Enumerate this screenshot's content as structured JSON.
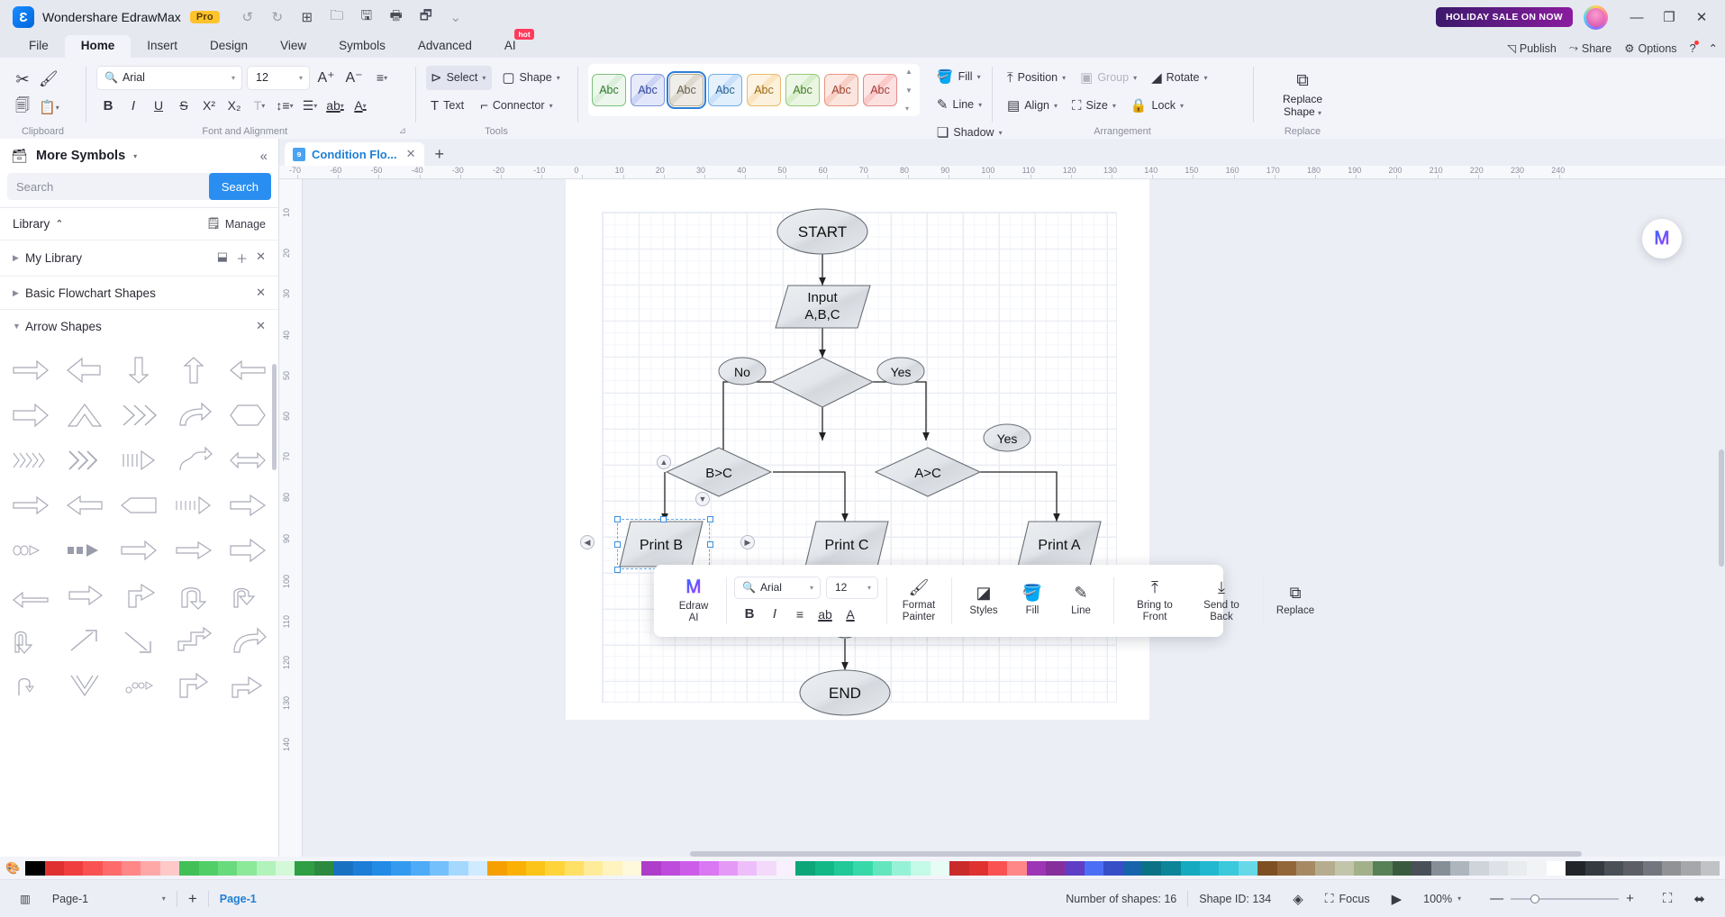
{
  "titlebar": {
    "app_name": "Wondershare EdrawMax",
    "pro_badge": "Pro",
    "quick_access": [
      {
        "name": "undo-icon",
        "glyph": "↩"
      },
      {
        "name": "redo-icon",
        "glyph": "↪"
      },
      {
        "name": "new-icon",
        "glyph": "⊞"
      },
      {
        "name": "open-icon",
        "glyph": "🗀"
      },
      {
        "name": "save-icon",
        "glyph": "🖫"
      },
      {
        "name": "print-icon",
        "glyph": "🖶"
      },
      {
        "name": "export-icon",
        "glyph": "🗗"
      },
      {
        "name": "more-icon",
        "glyph": "⌄"
      }
    ],
    "sale_label": "HOLIDAY SALE ON NOW",
    "minimize": "—",
    "maximize": "❐",
    "close": "✕"
  },
  "menubar": {
    "items": [
      {
        "label": "File",
        "active": false
      },
      {
        "label": "Home",
        "active": true
      },
      {
        "label": "Insert",
        "active": false
      },
      {
        "label": "Design",
        "active": false
      },
      {
        "label": "View",
        "active": false
      },
      {
        "label": "Symbols",
        "active": false
      },
      {
        "label": "Advanced",
        "active": false
      },
      {
        "label": "AI",
        "active": false,
        "badge": "hot"
      }
    ],
    "right": [
      {
        "label": "Publish",
        "icon": "publish-icon",
        "glyph": "◺"
      },
      {
        "label": "Share",
        "icon": "share-icon",
        "glyph": "⌁"
      },
      {
        "label": "Options",
        "icon": "gear-icon",
        "glyph": "⚙"
      },
      {
        "label": "",
        "icon": "help-icon",
        "glyph": "?"
      },
      {
        "label": "",
        "icon": "chevron-up-icon",
        "glyph": "⌃"
      }
    ]
  },
  "ribbon": {
    "groups": [
      {
        "name": "Clipboard",
        "label": "Clipboard"
      },
      {
        "name": "Font and Alignment",
        "label": "Font and Alignment"
      },
      {
        "name": "Tools",
        "label": "Tools"
      },
      {
        "name": "Styles",
        "label": "Styles"
      },
      {
        "name": "Arrangement",
        "label": "Arrangement"
      },
      {
        "name": "Replace",
        "label": "Replace"
      }
    ],
    "clipboard": {
      "cut": "✂",
      "format_painter": "🖌",
      "copy": "🗐",
      "paste": "📋"
    },
    "font": {
      "family_value": "Arial",
      "size_value": "12",
      "grow": "A⁺",
      "shrink": "A⁻",
      "align": "≡",
      "bold": "B",
      "italic": "I",
      "underline": "U",
      "strike": "S",
      "superscript": "X²",
      "subscript": "X₂",
      "textcase": "T",
      "linespacing": "↕≡",
      "bullets": "≔",
      "highlight": "ab",
      "fontcolor": "A"
    },
    "tools": {
      "select": "Select",
      "shape": "Shape",
      "text": "Text",
      "connector": "Connector"
    },
    "styles": {
      "swatch_label": "Abc",
      "swatches": [
        {
          "bg": "#d9 efd9",
          "border": "#6bbf6b",
          "fg": "#2f7a2f",
          "selected": false
        },
        {
          "bg": "#ccd4f5",
          "border": "#7287d6",
          "fg": "#33469e",
          "selected": false
        },
        {
          "bg": "#ded9cf",
          "border": "#b0a68f",
          "fg": "#6a6050",
          "selected": true
        },
        {
          "bg": "#c9e0fa",
          "border": "#6aa6e0",
          "fg": "#25608f",
          "selected": false
        },
        {
          "bg": "#fae5c0",
          "border": "#e2b25c",
          "fg": "#9a6a16",
          "selected": false
        },
        {
          "bg": "#d6edc9",
          "border": "#8cc46a",
          "fg": "#477a2b",
          "selected": false
        },
        {
          "bg": "#f8cfc4",
          "border": "#e08a72",
          "fg": "#9e4430",
          "selected": false
        },
        {
          "bg": "#fad0ce",
          "border": "#e07f7c",
          "fg": "#a23c38",
          "selected": false
        }
      ],
      "fill": "Fill",
      "line": "Line",
      "shadow": "Shadow"
    },
    "arrangement": {
      "position": "Position",
      "group": "Group",
      "rotate": "Rotate",
      "align": "Align",
      "size": "Size",
      "lock": "Lock"
    },
    "replace": {
      "label_line1": "Replace",
      "label_line2": "Shape"
    }
  },
  "sidebar": {
    "header_title": "More Symbols",
    "search_placeholder": "Search",
    "search_button": "Search",
    "library_label": "Library",
    "manage_label": "Manage",
    "categories": [
      {
        "label": "My Library",
        "expanded": false
      },
      {
        "label": "Basic Flowchart Shapes",
        "expanded": false
      },
      {
        "label": "Arrow Shapes",
        "expanded": true
      }
    ]
  },
  "canvas": {
    "tab_title": "Condition Flo...",
    "tab_close": "✕",
    "tab_add": "+",
    "h_ruler_ticks": [
      "-70",
      "-60",
      "-50",
      "-40",
      "-30",
      "-20",
      "-10",
      "0",
      "10",
      "20",
      "30",
      "40",
      "50",
      "60",
      "70",
      "80",
      "90",
      "100",
      "110",
      "120",
      "130",
      "140",
      "150",
      "160",
      "170",
      "180",
      "190",
      "200",
      "210",
      "220",
      "230",
      "240"
    ],
    "v_ruler_ticks": [
      "10",
      "20",
      "30",
      "40",
      "50",
      "60",
      "70",
      "80",
      "90",
      "100",
      "110",
      "120",
      "130",
      "140"
    ],
    "ai_button": "AI"
  },
  "diagram": {
    "title": "Condition Flowchart",
    "nodes": [
      {
        "id": "start",
        "label": "START",
        "type": "terminator"
      },
      {
        "id": "input",
        "label": "Input\nA,B,C",
        "type": "data"
      },
      {
        "id": "no1",
        "label": "No",
        "type": "label"
      },
      {
        "id": "yes1",
        "label": "Yes",
        "type": "label"
      },
      {
        "id": "yes2",
        "label": "Yes",
        "type": "label"
      },
      {
        "id": "bgtc",
        "label": "B>C",
        "type": "decision"
      },
      {
        "id": "agtc",
        "label": "A>C",
        "type": "decision"
      },
      {
        "id": "printb",
        "label": "Print B",
        "type": "data",
        "selected": true
      },
      {
        "id": "printc",
        "label": "Print C",
        "type": "data"
      },
      {
        "id": "printa",
        "label": "Print A",
        "type": "data"
      },
      {
        "id": "merge",
        "label": "",
        "type": "connector-circle"
      },
      {
        "id": "end",
        "label": "END",
        "type": "terminator"
      }
    ]
  },
  "floating_toolbar": {
    "edraw_ai": "Edraw AI",
    "font_family": "Arial",
    "font_size": "12",
    "bold": "B",
    "italic": "I",
    "align": "≡",
    "highlight": "ab",
    "fontcolor": "A",
    "buttons": [
      {
        "label": "Format\nPainter",
        "name": "format-painter",
        "glyph": "🖌"
      },
      {
        "label": "Styles",
        "name": "styles",
        "glyph": "◪"
      },
      {
        "label": "Fill",
        "name": "fill",
        "glyph": "🪣"
      },
      {
        "label": "Line",
        "name": "line",
        "glyph": "✎"
      },
      {
        "label": "Bring to Front",
        "name": "bring-to-front",
        "glyph": "⤒"
      },
      {
        "label": "Send to Back",
        "name": "send-to-back",
        "glyph": "⤓"
      },
      {
        "label": "Replace",
        "name": "replace",
        "glyph": "⇄"
      }
    ]
  },
  "statusbar": {
    "page_select": "Page-1",
    "add_page": "+",
    "page_tab": "Page-1",
    "shapes_count": "Number of shapes: 16",
    "shape_id": "Shape ID: 134",
    "focus": "Focus",
    "zoom": "100%",
    "zoom_out": "—",
    "zoom_in": "+"
  },
  "palette": {
    "colors": [
      "#000000",
      "#e03131",
      "#f03e3e",
      "#fa5252",
      "#ff6b6b",
      "#ff8787",
      "#ffa8a8",
      "#ffc9c9",
      "#40c057",
      "#51cf66",
      "#69db7c",
      "#8ce99a",
      "#b2f2bb",
      "#d3f9d8",
      "#2f9e44",
      "#2b8a3e",
      "#1971c2",
      "#1c7ed6",
      "#228be6",
      "#339af0",
      "#4dabf7",
      "#74c0fc",
      "#a5d8ff",
      "#d0ebff",
      "#f59f00",
      "#fab005",
      "#fcc419",
      "#ffd43b",
      "#ffe066",
      "#ffec99",
      "#fff3bf",
      "#fff9db",
      "#ae3ec9",
      "#be4bdb",
      "#cc5de8",
      "#da77f2",
      "#e599f7",
      "#eebefa",
      "#f3d9fa",
      "#f8f0fc",
      "#0ca678",
      "#12b886",
      "#20c997",
      "#38d9a9",
      "#63e6be",
      "#96f2d7",
      "#c3fae8",
      "#e6fcf5",
      "#c92a2a",
      "#e03131",
      "#fa5252",
      "#ff8787",
      "#9c36b5",
      "#862e9c",
      "#5f3dc4",
      "#4c6ef5",
      "#364fc7",
      "#1864ab",
      "#0b7285",
      "#0c8599",
      "#15aabf",
      "#22b8cf",
      "#3bc9db",
      "#66d9e8",
      "#7f4f24",
      "#936639",
      "#a68a64",
      "#b6ad90",
      "#c2c5aa",
      "#a3b18a",
      "#588157",
      "#3a5a40",
      "#495057",
      "#868e96",
      "#adb5bd",
      "#ced4da",
      "#dee2e6",
      "#e9ecef",
      "#f1f3f5",
      "#ffffff",
      "#212529",
      "#343a40",
      "#495057",
      "#5c5f66",
      "#73767f",
      "#909296",
      "#a6a7ab",
      "#c1c2c5"
    ]
  }
}
